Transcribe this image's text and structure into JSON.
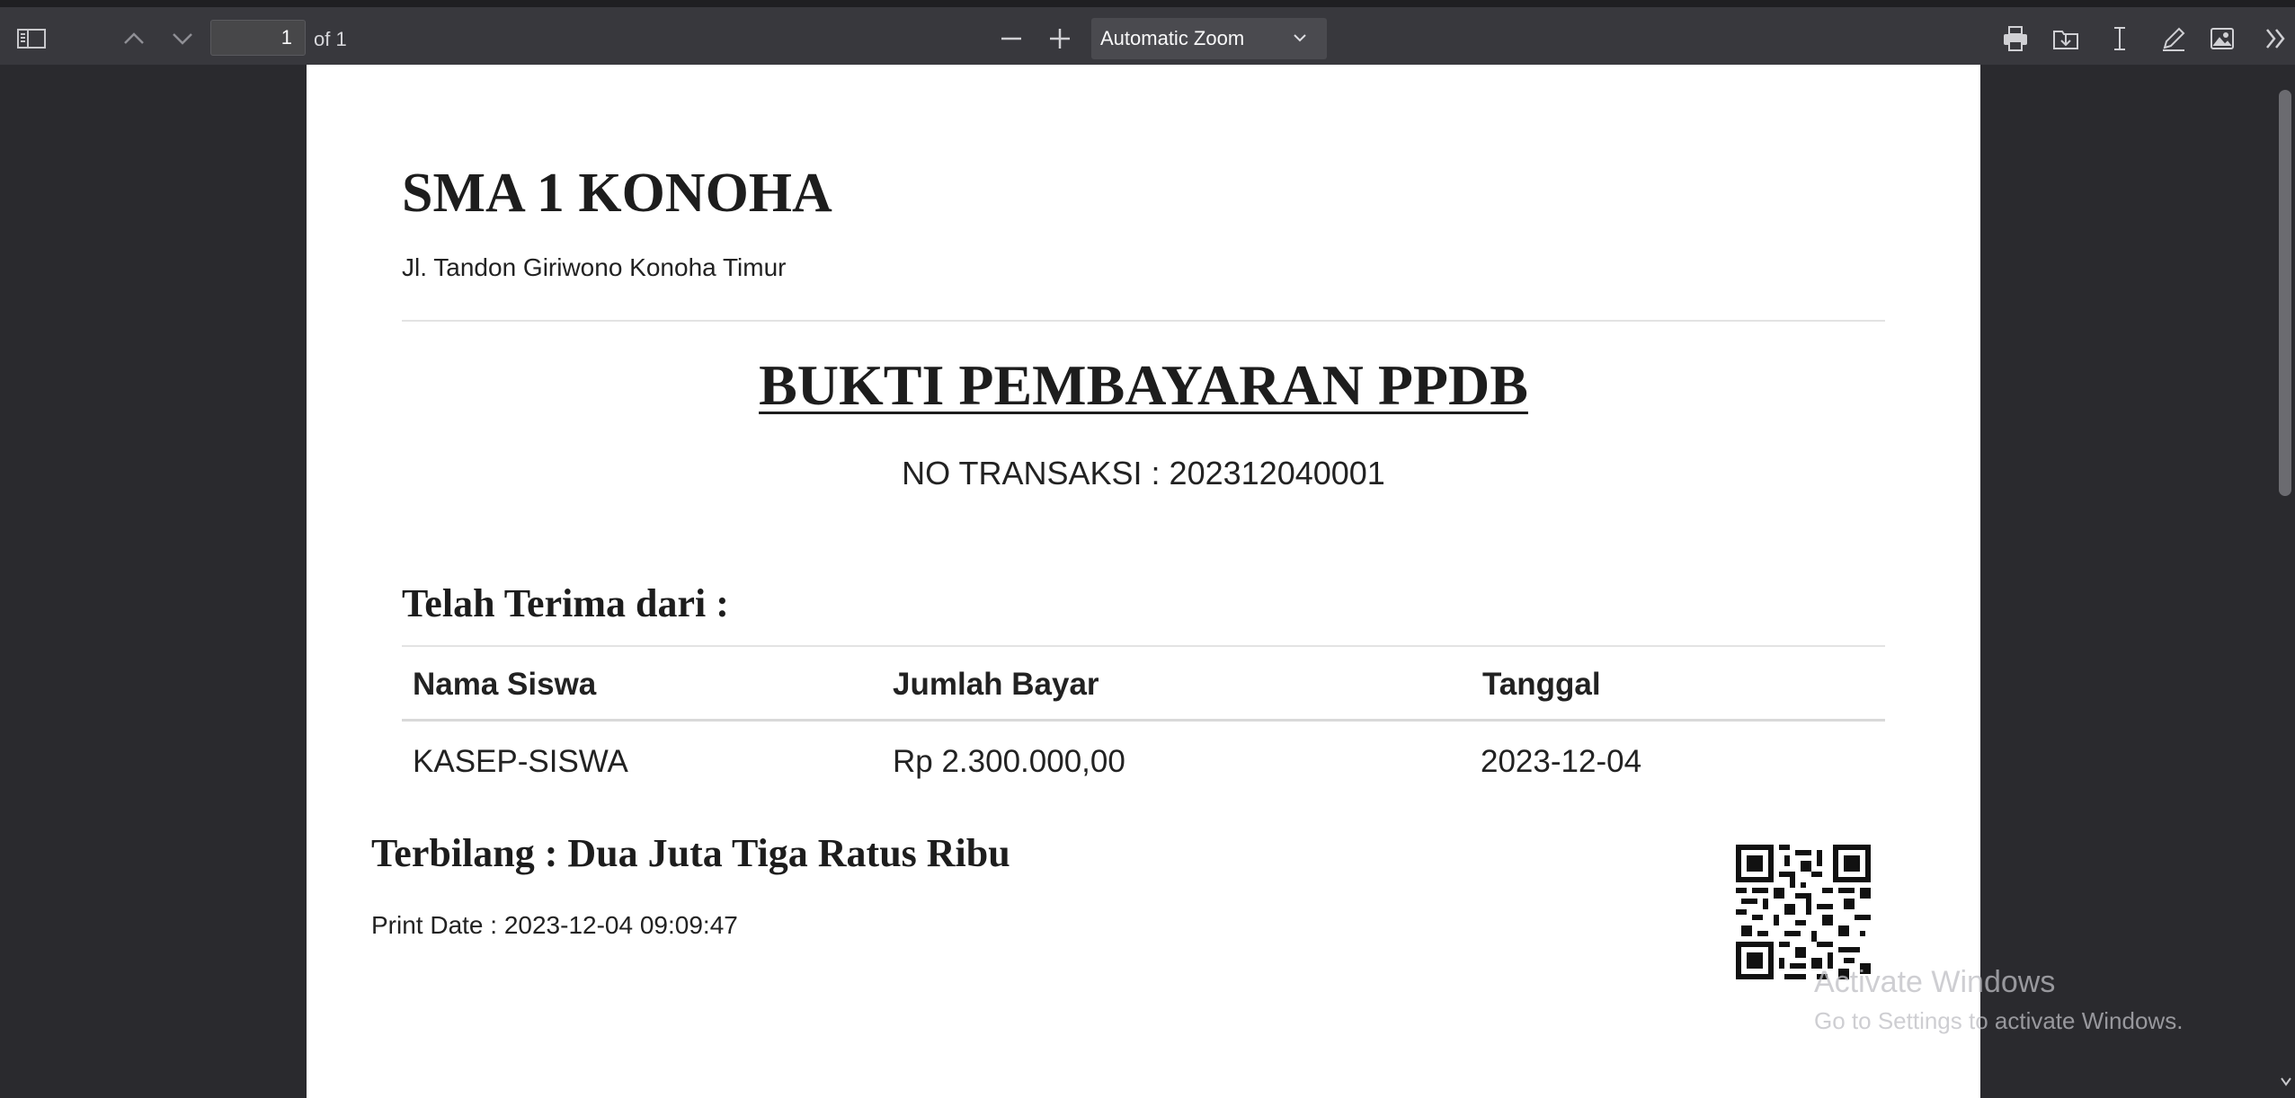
{
  "toolbar": {
    "page_number": "1",
    "page_count_label": "of 1",
    "zoom_label": "Automatic Zoom"
  },
  "document": {
    "school_name": "SMA 1 KONOHA",
    "address": "Jl. Tandon Giriwono Konoha Timur",
    "title": "BUKTI PEMBAYARAN PPDB",
    "transaction": "NO TRANSAKSI : 202312040001",
    "received_from_label": "Telah Terima dari :",
    "table": {
      "headers": [
        "Nama Siswa",
        "Jumlah Bayar",
        "Tanggal"
      ],
      "rows": [
        [
          "KASEP-SISWA",
          "Rp 2.300.000,00",
          "2023-12-04"
        ]
      ]
    },
    "amount_in_words": "Terbilang : Dua Juta Tiga Ratus Ribu",
    "print_date": "Print Date : 2023-12-04 09:09:47"
  },
  "watermark": {
    "line1": "Activate Windows",
    "line2": "Go to Settings to activate Windows."
  },
  "icons": {
    "sidebar": "sidebar-toggle-icon",
    "prev": "chevron-up-icon",
    "next": "chevron-down-icon",
    "zoom_out": "minus-icon",
    "zoom_in": "plus-icon",
    "print": "print-icon",
    "save": "download-icon",
    "text_select": "text-cursor-icon",
    "draw": "pencil-icon",
    "image": "image-icon",
    "more": "double-chevron-right-icon"
  }
}
